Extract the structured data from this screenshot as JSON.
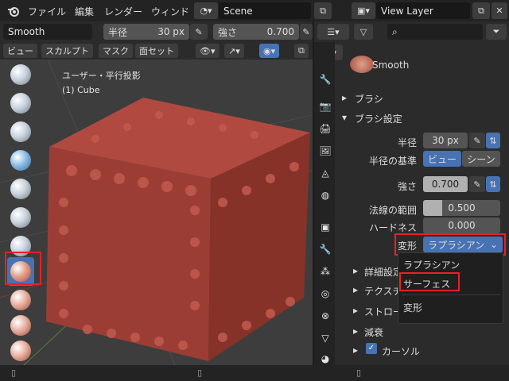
{
  "menu": {
    "items": [
      "ファイル",
      "編集",
      "レンダー",
      "ウィンド"
    ],
    "scene": "Scene",
    "view_layer": "View Layer"
  },
  "tool_header": {
    "brush_name": "Smooth",
    "radius_label": "半径",
    "radius_value": "30 px",
    "strength_label": "強さ",
    "strength_value": "0.700"
  },
  "viewport_header": {
    "buttons": [
      "ビュー",
      "スカルプト",
      "マスク",
      "面セット"
    ]
  },
  "viewport": {
    "overlay_line1": "ユーザー・平行投影",
    "overlay_line2": "(1) Cube"
  },
  "panel": {
    "brush_title": "Smooth",
    "section_brush": "ブラシ",
    "section_brush_settings": "ブラシ設定",
    "radius_label": "半径",
    "radius_value": "30 px",
    "radius_unit_label": "半径の基準",
    "unit_view": "ビュー",
    "unit_scene": "シーン",
    "strength_label": "強さ",
    "strength_value": "0.700",
    "normal_radius_label": "法線の範囲",
    "normal_radius_value": "0.500",
    "hardness_label": "ハードネス",
    "hardness_value": "0.000",
    "deform_label": "変形",
    "deform_value": "ラプラシアン",
    "sub_sections": [
      "詳細設定",
      "テクスチ",
      "ストロー",
      "減衰",
      "カーソル"
    ]
  },
  "dropdown": {
    "options": [
      "ラプラシアン",
      "サーフェス"
    ],
    "header": "変形"
  },
  "colors": {
    "accent": "#4772b3",
    "highlight_red": "#e8202a",
    "cube": "#a8433b"
  }
}
